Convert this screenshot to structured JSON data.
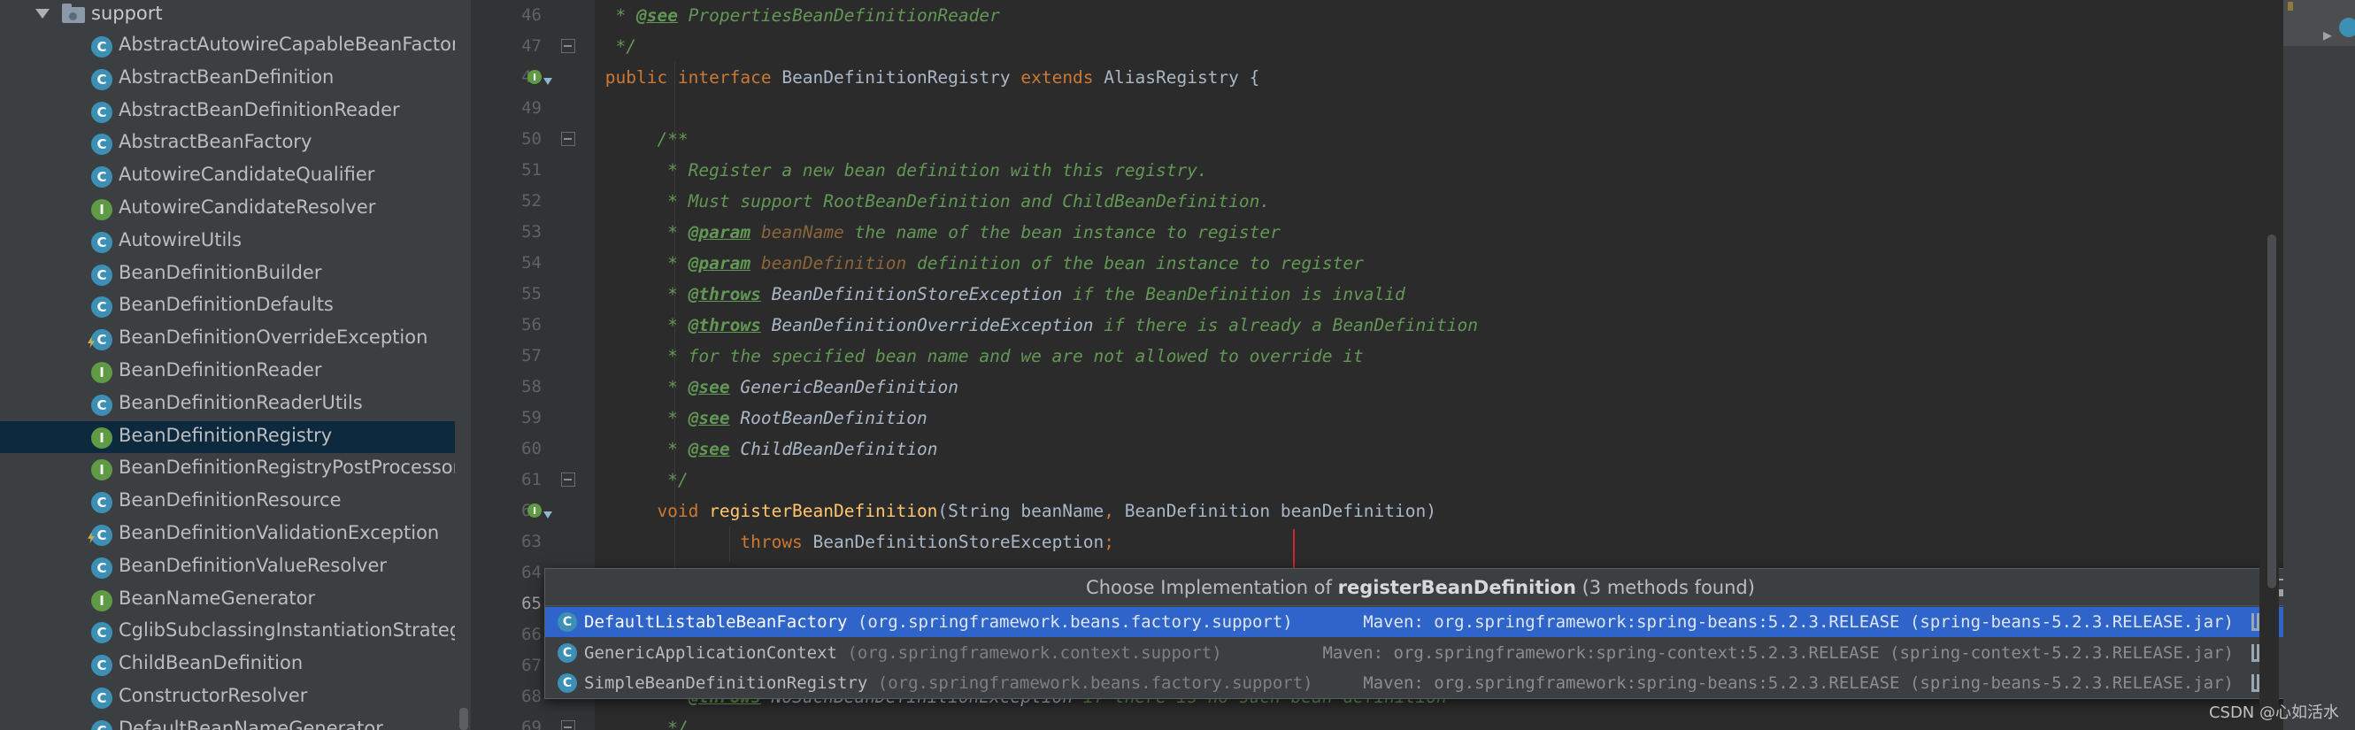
{
  "project_tree": {
    "folder_label": "support",
    "items": [
      {
        "name": "AbstractAutowireCapableBeanFactory",
        "kind": "abstract-class"
      },
      {
        "name": "AbstractBeanDefinition",
        "kind": "abstract-class"
      },
      {
        "name": "AbstractBeanDefinitionReader",
        "kind": "abstract-class"
      },
      {
        "name": "AbstractBeanFactory",
        "kind": "abstract-class"
      },
      {
        "name": "AutowireCandidateQualifier",
        "kind": "class"
      },
      {
        "name": "AutowireCandidateResolver",
        "kind": "interface"
      },
      {
        "name": "AutowireUtils",
        "kind": "class"
      },
      {
        "name": "BeanDefinitionBuilder",
        "kind": "class"
      },
      {
        "name": "BeanDefinitionDefaults",
        "kind": "class"
      },
      {
        "name": "BeanDefinitionOverrideException",
        "kind": "exception"
      },
      {
        "name": "BeanDefinitionReader",
        "kind": "interface"
      },
      {
        "name": "BeanDefinitionReaderUtils",
        "kind": "class"
      },
      {
        "name": "BeanDefinitionRegistry",
        "kind": "interface",
        "selected": true
      },
      {
        "name": "BeanDefinitionRegistryPostProcessor",
        "kind": "interface"
      },
      {
        "name": "BeanDefinitionResource",
        "kind": "class"
      },
      {
        "name": "BeanDefinitionValidationException",
        "kind": "exception"
      },
      {
        "name": "BeanDefinitionValueResolver",
        "kind": "class"
      },
      {
        "name": "BeanNameGenerator",
        "kind": "interface"
      },
      {
        "name": "CglibSubclassingInstantiationStrategy",
        "kind": "class"
      },
      {
        "name": "ChildBeanDefinition",
        "kind": "class"
      },
      {
        "name": "ConstructorResolver",
        "kind": "class"
      },
      {
        "name": "DefaultBeanNameGenerator",
        "kind": "class"
      }
    ]
  },
  "editor": {
    "line_numbers": [
      "46",
      "47",
      "48",
      "49",
      "50",
      "51",
      "52",
      "53",
      "54",
      "55",
      "56",
      "57",
      "58",
      "59",
      "60",
      "61",
      "62",
      "63",
      "64",
      "65",
      "66",
      "67",
      "68",
      "69"
    ],
    "current_line": "65"
  },
  "popup": {
    "title_prefix": "Choose Implementation of ",
    "title_method": "registerBeanDefinition",
    "title_suffix": " (3 methods found)",
    "rows": [
      {
        "name": "DefaultListableBeanFactory",
        "package": "(org.springframework.beans.factory.support)",
        "library": "Maven: org.springframework:spring-beans:5.2.3.RELEASE (spring-beans-5.2.3.RELEASE.jar)",
        "icon_letter": "C"
      },
      {
        "name": "GenericApplicationContext",
        "package": "(org.springframework.context.support)",
        "library": "Maven: org.springframework:spring-context:5.2.3.RELEASE (spring-context-5.2.3.RELEASE.jar)",
        "icon_letter": "C"
      },
      {
        "name": "SimpleBeanDefinitionRegistry",
        "package": "(org.springframework.beans.factory.support)",
        "library": "Maven: org.springframework:spring-beans:5.2.3.RELEASE (spring-beans-5.2.3.RELEASE.jar)",
        "icon_letter": "C"
      }
    ]
  },
  "gutter_icons": {
    "impl_letter": "I"
  },
  "watermark": "CSDN @心如活水",
  "colors": {
    "selection_blue": "#2f65ca",
    "class_icon": "#3c8fb5",
    "interface_icon": "#5f9b44",
    "comment_green": "#629755",
    "keyword_orange": "#cc7832",
    "method_yellow": "#ffc66d",
    "annotation_red": "#c8272d"
  }
}
